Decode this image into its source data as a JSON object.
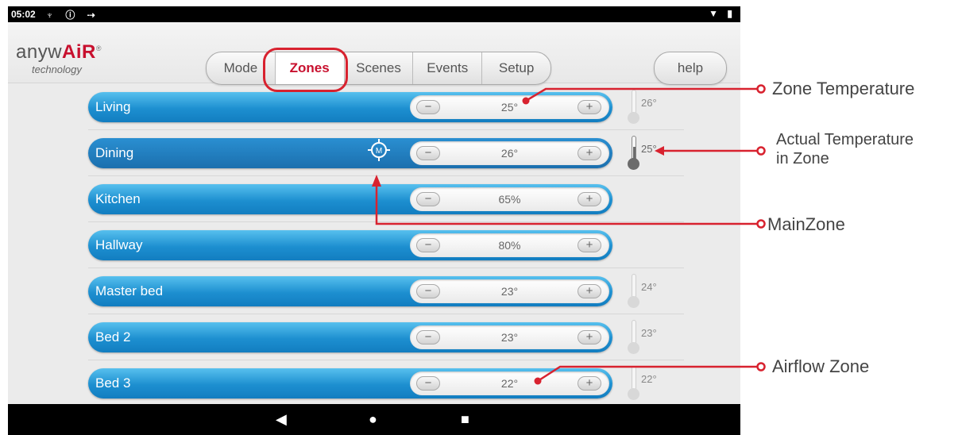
{
  "status_bar": {
    "time": "05:02",
    "left_icons": "♆ ⓘ ⇢",
    "right_icons": "▼ ▮"
  },
  "logo": {
    "text_a": "anyw",
    "text_b": "AiR",
    "registered": "®",
    "subtitle": "technology"
  },
  "tabs": [
    {
      "label": "Mode",
      "active": false
    },
    {
      "label": "Zones",
      "active": true
    },
    {
      "label": "Scenes",
      "active": false
    },
    {
      "label": "Events",
      "active": false
    },
    {
      "label": "Setup",
      "active": false
    }
  ],
  "help_label": "help",
  "zones": [
    {
      "name": "Living",
      "setpoint": "25°",
      "actual": "26°",
      "minus": "−",
      "plus": "+"
    },
    {
      "name": "Dining",
      "setpoint": "26°",
      "actual": "25°",
      "minus": "−",
      "plus": "+",
      "main_zone_badge": "M"
    },
    {
      "name": "Kitchen",
      "setpoint": "65%",
      "minus": "−",
      "plus": "+"
    },
    {
      "name": "Hallway",
      "setpoint": "80%",
      "minus": "−",
      "plus": "+"
    },
    {
      "name": "Master bed",
      "setpoint": "23°",
      "actual": "24°",
      "minus": "−",
      "plus": "+"
    },
    {
      "name": "Bed 2",
      "setpoint": "23°",
      "actual": "23°",
      "minus": "−",
      "plus": "+"
    },
    {
      "name": "Bed 3",
      "setpoint": "22°",
      "actual": "22°",
      "minus": "−",
      "plus": "+"
    }
  ],
  "nav_bar": {
    "back": "◀",
    "home": "●",
    "recents": "■"
  },
  "annotations": {
    "zone_temperature": "Zone Temperature",
    "actual_temperature_line1": "Actual Temperature",
    "actual_temperature_line2": "in Zone",
    "main_zone": "MainZone",
    "airflow_zone": "Airflow Zone"
  },
  "colors": {
    "accent": "#c8102e",
    "zone_bar": "#1d8fd0",
    "annotation": "#d8222f"
  }
}
